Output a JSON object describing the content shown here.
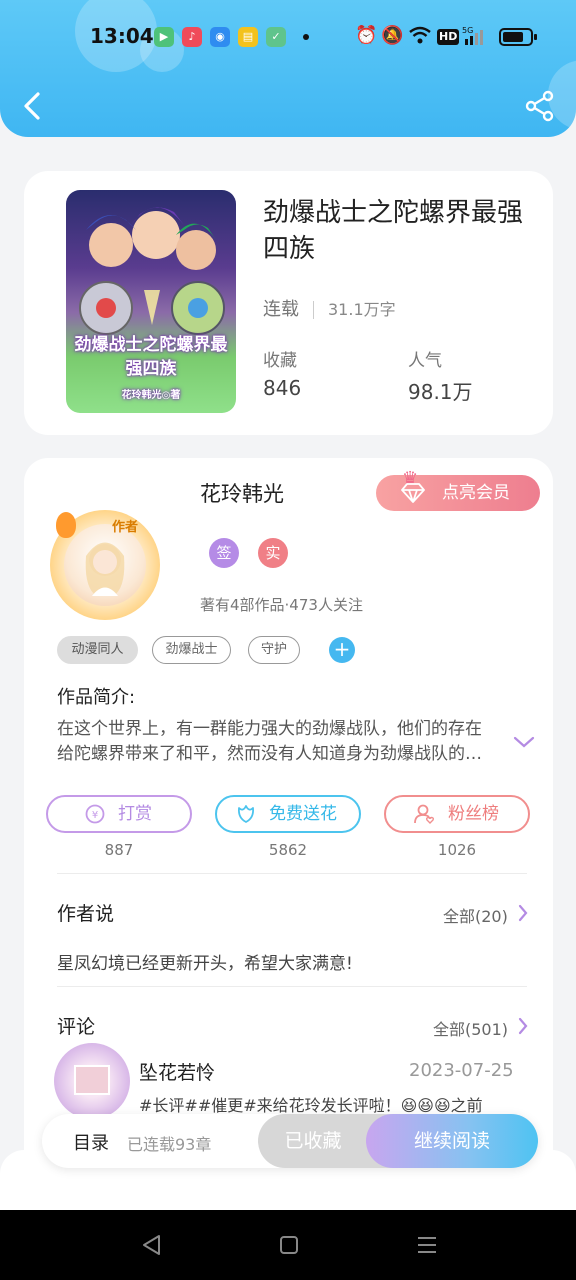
{
  "status_bar": {
    "time": "13:04",
    "app_icons": [
      "video-app-icon",
      "music-app-icon",
      "camera-app-icon",
      "notes-app-icon",
      "shield-app-icon"
    ],
    "system_icons": [
      "alarm-icon",
      "mute-icon",
      "wifi-icon",
      "hd-icon",
      "signal-5g-icon",
      "battery-icon"
    ],
    "hd_label": "HD",
    "net_label": "5G"
  },
  "header": {
    "accent_color": "#3fb6f2",
    "back_icon": "chevron-left-icon",
    "share_icon": "share-icon"
  },
  "book": {
    "cover_text": "劲爆战士之陀螺界最强四族",
    "cover_author": "花玲韩光◎著",
    "title": "劲爆战士之陀螺界最强四族",
    "status": "连载",
    "word_count": "31.1万字",
    "collect_label": "收藏",
    "collect_value": "846",
    "popularity_label": "人气",
    "popularity_value": "98.1万"
  },
  "author": {
    "avatar_tag": "作者",
    "name": "花玲韩光",
    "vip_label": "点亮会员",
    "badges": [
      {
        "text": "签",
        "color": "#b58be6"
      },
      {
        "text": "实",
        "color": "#f07f86"
      }
    ],
    "stats": "著有4部作品·473人关注"
  },
  "tags": [
    "动漫同人",
    "劲爆战士",
    "守护"
  ],
  "intro": {
    "label": "作品简介:",
    "line1": "在这个世界上，有一群能力强大的劲爆战队，他们的存在",
    "line2": "给陀螺界带来了和平，然而没有人知道身为劲爆战队的队..."
  },
  "actions": [
    {
      "label": "打赏",
      "count": "887",
      "icon": "coin-icon",
      "color": "#c49ae8"
    },
    {
      "label": "免费送花",
      "count": "5862",
      "icon": "flower-icon",
      "color": "#4cc4ee"
    },
    {
      "label": "粉丝榜",
      "count": "1026",
      "icon": "fan-icon",
      "color": "#f18e8e"
    }
  ],
  "author_says": {
    "title": "作者说",
    "more": "全部(20)",
    "text": "星凤幻境已经更新开头，希望大家满意!"
  },
  "comments": {
    "title": "评论",
    "more": "全部(501)",
    "user": "坠花若怜",
    "date": "2023-07-25",
    "text": "#长评##催更#来给花玲发长评啦！😆😆😆之前"
  },
  "bottom_bar": {
    "toc_label": "目录",
    "chapters": "已连载93章",
    "collected_label": "已收藏",
    "read_label": "继续阅读"
  },
  "navbar": {
    "buttons": [
      "nav-back-icon",
      "nav-home-icon",
      "nav-menu-icon"
    ]
  }
}
